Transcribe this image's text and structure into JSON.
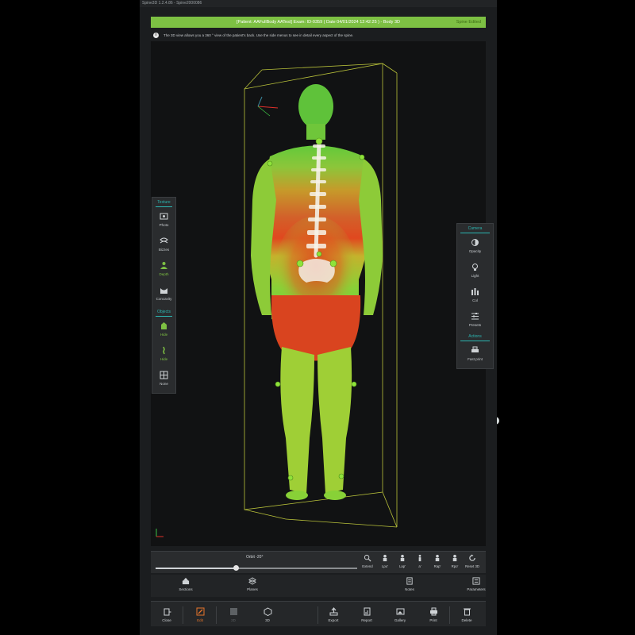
{
  "window": {
    "title": "Spine3D 1.2.4.86 - Spine2000086"
  },
  "header": {
    "patient_text": "[Patient: AAFullBody AATest]  Exam: ID-0359 ( Date 04/01/2024 12:42:25 ) - Body 3D",
    "status_text": "Spine Edited"
  },
  "info": {
    "icon": "i",
    "text": "The 3D view allows you a 360 ° view of the patient's back. Use the side menus to see in detail every aspect of the spine."
  },
  "left_panel": {
    "texture_title": "Texture",
    "texture_items": [
      {
        "label": "Photo",
        "icon": "photo-icon"
      },
      {
        "label": "Bizzes",
        "icon": "bizzes-icon"
      },
      {
        "label": "Depth",
        "icon": "depth-icon",
        "active": true
      },
      {
        "label": "Concavity",
        "icon": "concavity-icon"
      }
    ],
    "objects_title": "Objects",
    "object_items": [
      {
        "label": "Hide",
        "icon": "figure-icon",
        "active": true
      },
      {
        "label": "Hide",
        "icon": "spine-icon",
        "active": true
      },
      {
        "label": "None",
        "icon": "grid-icon"
      }
    ]
  },
  "right_panel": {
    "camera_title": "Camera",
    "camera_items": [
      {
        "label": "Opacity",
        "icon": "opacity-icon"
      },
      {
        "label": "Light",
        "icon": "light-icon"
      },
      {
        "label": "Col",
        "icon": "color-icon"
      },
      {
        "label": "Presets",
        "icon": "presets-icon"
      }
    ],
    "actions_title": "Actions",
    "action_items": [
      {
        "label": "Fast print",
        "icon": "printer-icon"
      }
    ]
  },
  "orbit": {
    "label": "Orbit  -20°",
    "slider_value": 0.4,
    "buttons": [
      {
        "label": "Extend",
        "icon": "zoom-icon"
      },
      {
        "label": "Lpo'",
        "icon": "view-lpo-icon"
      },
      {
        "label": "Lap'",
        "icon": "view-lap-icon"
      },
      {
        "label": "a'",
        "icon": "view-a-icon"
      },
      {
        "label": "Rap'",
        "icon": "view-rap-icon"
      },
      {
        "label": "Rpo'",
        "icon": "view-rpo-icon"
      },
      {
        "label": "Reset 3D",
        "icon": "reset-icon"
      }
    ]
  },
  "sections": [
    {
      "label": "Sections",
      "icon": "sections-icon"
    },
    {
      "label": "Planes",
      "icon": "planes-icon"
    },
    {
      "label": "Notes",
      "icon": "notes-icon"
    },
    {
      "label": "Parameters",
      "icon": "parameters-icon"
    }
  ],
  "toolbar": [
    {
      "label": "Close",
      "icon": "close-icon"
    },
    {
      "label": "Edit",
      "icon": "edit-icon",
      "active": true
    },
    {
      "label": "2D",
      "icon": "2d-icon",
      "disabled": true
    },
    {
      "label": "3D",
      "icon": "3d-icon"
    },
    {
      "label": "Export",
      "icon": "export-icon"
    },
    {
      "label": "Report",
      "icon": "report-icon"
    },
    {
      "label": "Gallery",
      "icon": "gallery-icon"
    },
    {
      "label": "Print",
      "icon": "print-icon"
    },
    {
      "label": "Delete",
      "icon": "delete-icon"
    }
  ],
  "colors": {
    "accent_green": "#7dc043",
    "accent_teal": "#2bb5b0",
    "active_orange": "#e8742a"
  }
}
